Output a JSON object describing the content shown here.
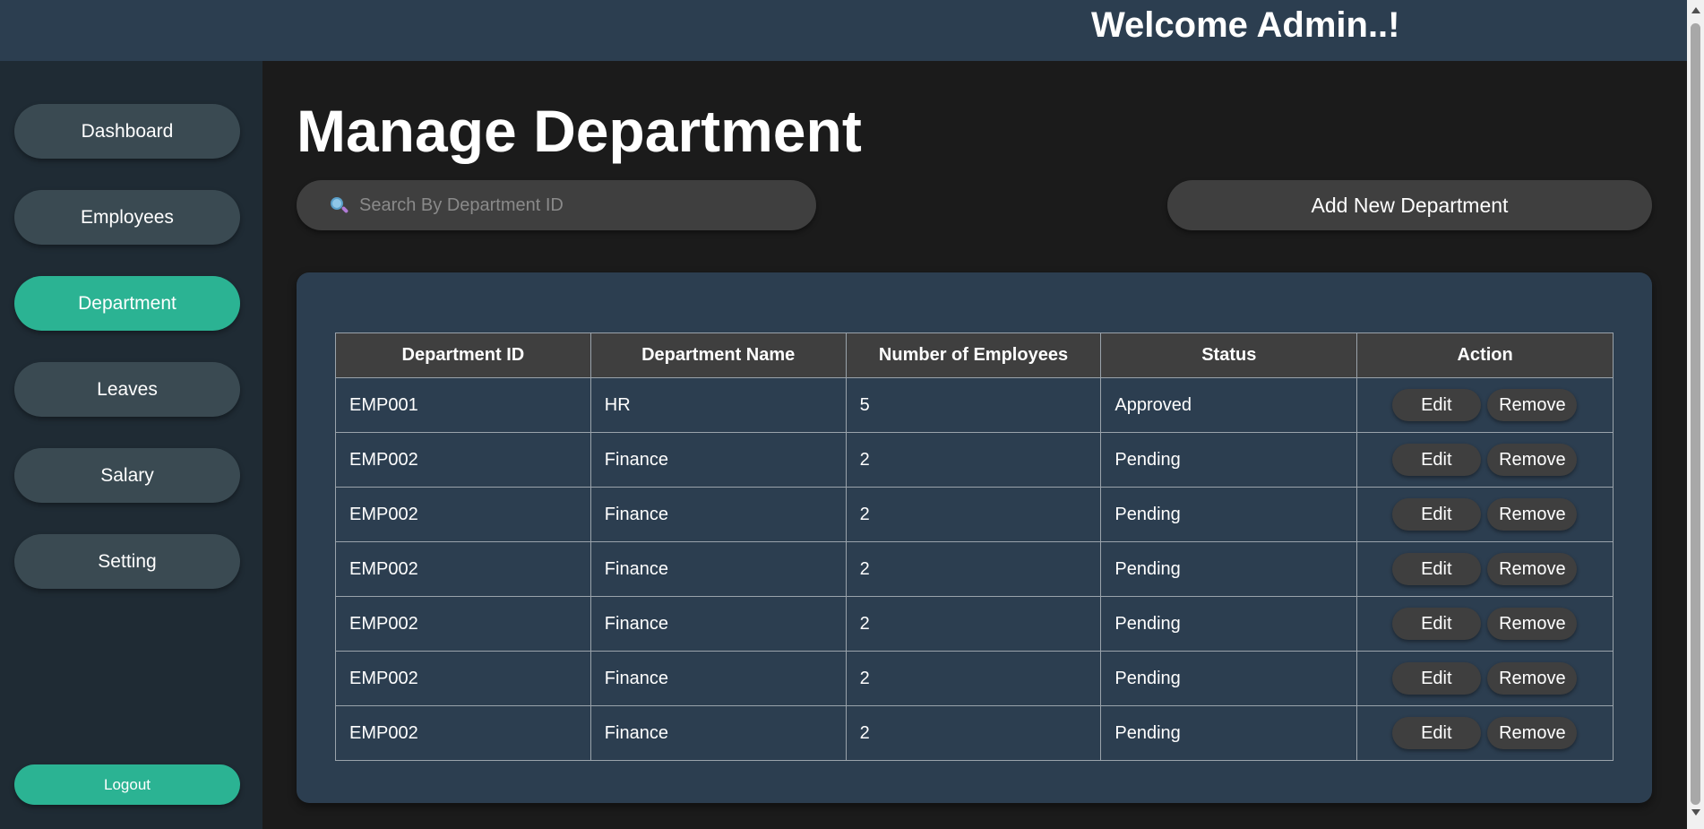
{
  "header": {
    "welcome": "Welcome Admin..!"
  },
  "sidebar": {
    "items": [
      {
        "label": "Dashboard",
        "active": false
      },
      {
        "label": "Employees",
        "active": false
      },
      {
        "label": "Department",
        "active": true
      },
      {
        "label": "Leaves",
        "active": false
      },
      {
        "label": "Salary",
        "active": false
      },
      {
        "label": "Setting",
        "active": false
      }
    ],
    "logout_label": "Logout"
  },
  "main": {
    "title": "Manage Department",
    "search": {
      "placeholder": "Search By Department ID",
      "value": ""
    },
    "add_label": "Add New Department"
  },
  "table": {
    "headers": [
      "Department ID",
      "Department Name",
      "Number of Employees",
      "Status",
      "Action"
    ],
    "rows": [
      {
        "id": "EMP001",
        "name": "HR",
        "count": "5",
        "status": "Approved"
      },
      {
        "id": "EMP002",
        "name": "Finance",
        "count": "2",
        "status": "Pending"
      },
      {
        "id": "EMP002",
        "name": "Finance",
        "count": "2",
        "status": "Pending"
      },
      {
        "id": "EMP002",
        "name": "Finance",
        "count": "2",
        "status": "Pending"
      },
      {
        "id": "EMP002",
        "name": "Finance",
        "count": "2",
        "status": "Pending"
      },
      {
        "id": "EMP002",
        "name": "Finance",
        "count": "2",
        "status": "Pending"
      },
      {
        "id": "EMP002",
        "name": "Finance",
        "count": "2",
        "status": "Pending"
      }
    ],
    "edit_label": "Edit",
    "remove_label": "Remove"
  },
  "colors": {
    "topbar": "#2c3e50",
    "sidebar": "#1f2b34",
    "accent": "#2bb393",
    "card": "#2c3e50",
    "button": "#3f3f3f"
  },
  "icons": {
    "search": "search-icon"
  }
}
